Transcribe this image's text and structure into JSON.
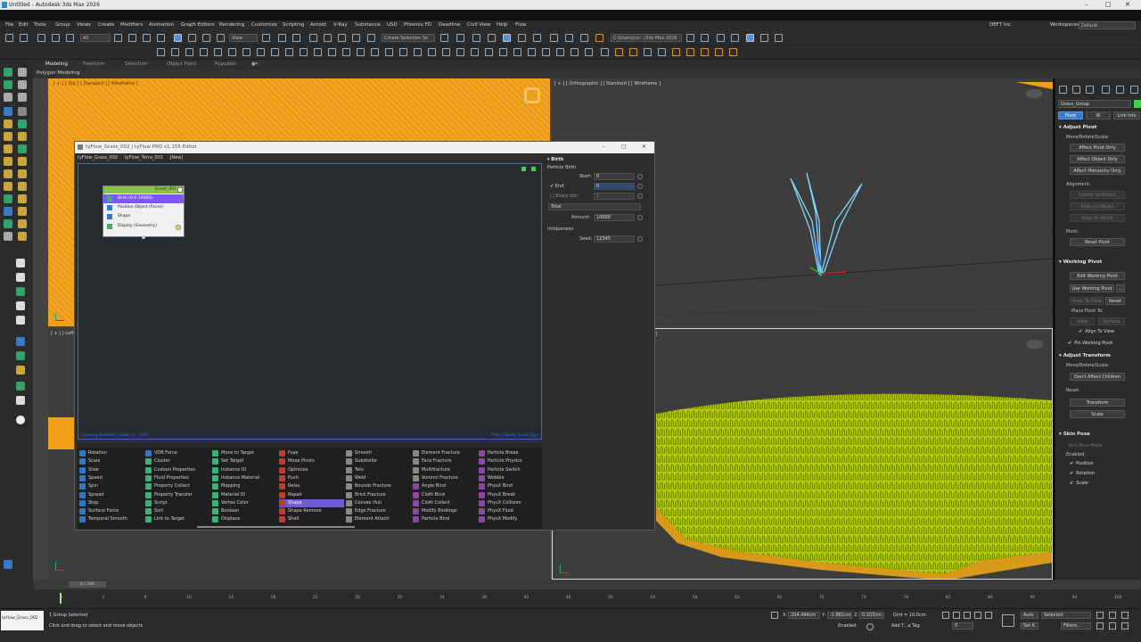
{
  "window": {
    "title": "Untitled - Autodesk 3ds Max 2026",
    "controls": [
      "–",
      "□",
      "✕"
    ]
  },
  "menu": [
    "File",
    "Edit",
    "Tools",
    "Group",
    "Views",
    "Create",
    "Modifiers",
    "Animation",
    "Graph Editors",
    "Rendering",
    "Customize",
    "Scripting",
    "Arnold",
    "V-Ray",
    "Substance",
    "USD",
    "Phoenix FD",
    "Deadline",
    "Civil View",
    "Help",
    "Flow"
  ],
  "account": "DEFT Inc.",
  "workspaces_label": "Workspaces:",
  "workspaces_value": "Default",
  "toolbar": {
    "filter_drop": "All",
    "view_drop": "View",
    "selection_set": "Create Selection Se",
    "project_path": "C:\\Users\\cor...\\3ds Max 2026"
  },
  "ribbon": {
    "tabs": [
      "Modeling",
      "Freeform",
      "Selection",
      "Object Paint",
      "Populate"
    ],
    "active_tab": "Modeling",
    "sub_label": "Polygon Modeling"
  },
  "viewports": {
    "top_left_label": "[ + ] [ Top ] [ Standard ] [ Wireframe ]",
    "top_right_label": "[ + ] [ Orthographic ] [ Standard ] [ Wireframe ]",
    "bottom_left_label": "[ + ] [ Left ]",
    "bottom_right_label": "]"
  },
  "tyflow": {
    "title": "tyFlow_Grass_002 | tyFlow PRO v1.155 Editor",
    "tabs": [
      "tyFlow_Grass_002",
      "tyFlow_Terra_001",
      "[New]"
    ],
    "event": {
      "name": "Event_001",
      "operators": [
        {
          "label": "Birth (0-0 10000)",
          "color": "#3bb273",
          "selected": true
        },
        {
          "label": "Position Object (Faces)",
          "color": "#2e79c7",
          "selected": false
        },
        {
          "label": "Shape",
          "color": "#2e79c7",
          "selected": false
        },
        {
          "label": "Display (Geometry)",
          "color": "#3bb273",
          "selected": false
        }
      ]
    },
    "status_left": "Caching enabled | Static [0 , 100]",
    "status_right": "Press Tab for QuickType",
    "props": {
      "section": "Birth",
      "sub": "Particle Birth",
      "start_label": "Start:",
      "start_value": "0",
      "end_label": "End:",
      "end_value": "0",
      "every_nth_label": "Every nth:",
      "every_nth_value": "1",
      "mode": "Total",
      "amount_label": "Amount:",
      "amount_value": "10000",
      "uniqueness_label": "Uniqueness",
      "seed_label": "Seed:",
      "seed_value": "12345"
    },
    "palette": [
      [
        {
          "l": "Rotation",
          "c": "#2e79c7"
        },
        {
          "l": "Scale",
          "c": "#2e79c7"
        },
        {
          "l": "Slow",
          "c": "#2e79c7"
        },
        {
          "l": "Speed",
          "c": "#2e79c7"
        },
        {
          "l": "Spin",
          "c": "#2e79c7"
        },
        {
          "l": "Spread",
          "c": "#2e79c7"
        },
        {
          "l": "Stop",
          "c": "#2e79c7"
        },
        {
          "l": "Surface Force",
          "c": "#2e79c7"
        },
        {
          "l": "Temporal Smooth",
          "c": "#2e79c7"
        }
      ],
      [
        {
          "l": "VDB Force",
          "c": "#2e79c7"
        },
        {
          "l": "Cluster",
          "c": "#3bb273"
        },
        {
          "l": "Custom Properties",
          "c": "#3bb273"
        },
        {
          "l": "Fluid Properties",
          "c": "#3bb273"
        },
        {
          "l": "Property Collect",
          "c": "#3bb273"
        },
        {
          "l": "Property Transfer",
          "c": "#3bb273"
        },
        {
          "l": "Script",
          "c": "#3bb273"
        },
        {
          "l": "Sort",
          "c": "#3bb273"
        },
        {
          "l": "Link to Target",
          "c": "#3bb273"
        }
      ],
      [
        {
          "l": "Move to Target",
          "c": "#3bb273"
        },
        {
          "l": "Set Target",
          "c": "#3bb273"
        },
        {
          "l": "Instance ID",
          "c": "#3bb273"
        },
        {
          "l": "Instance Material",
          "c": "#3bb273"
        },
        {
          "l": "Mapping",
          "c": "#3bb273"
        },
        {
          "l": "Material ID",
          "c": "#3bb273"
        },
        {
          "l": "Vertex Color",
          "c": "#3bb273"
        },
        {
          "l": "Boolean",
          "c": "#3bb273"
        },
        {
          "l": "Displace",
          "c": "#3bb273"
        }
      ],
      [
        {
          "l": "Fuse",
          "c": "#c0392b"
        },
        {
          "l": "Move Pivots",
          "c": "#c0392b"
        },
        {
          "l": "Optimize",
          "c": "#c0392b"
        },
        {
          "l": "Push",
          "c": "#c0392b"
        },
        {
          "l": "Relax",
          "c": "#c0392b"
        },
        {
          "l": "Repair",
          "c": "#c0392b"
        },
        {
          "l": "Shape",
          "c": "#c0392b",
          "hl": true
        },
        {
          "l": "Shape Remove",
          "c": "#c0392b"
        },
        {
          "l": "Shell",
          "c": "#c0392b"
        }
      ],
      [
        {
          "l": "Smooth",
          "c": "#888888"
        },
        {
          "l": "Subdivide",
          "c": "#888888"
        },
        {
          "l": "Tets",
          "c": "#888888"
        },
        {
          "l": "Weld",
          "c": "#888888"
        },
        {
          "l": "Bounds Fracture",
          "c": "#888888"
        },
        {
          "l": "Brick Fracture",
          "c": "#888888"
        },
        {
          "l": "Convex Hull",
          "c": "#888888"
        },
        {
          "l": "Edge Fracture",
          "c": "#888888"
        },
        {
          "l": "Element Attach",
          "c": "#888888"
        }
      ],
      [
        {
          "l": "Element Fracture",
          "c": "#888888"
        },
        {
          "l": "Face Fracture",
          "c": "#888888"
        },
        {
          "l": "Multifracture",
          "c": "#888888"
        },
        {
          "l": "Voronoi Fracture",
          "c": "#888888"
        },
        {
          "l": "Angle Bind",
          "c": "#8e44ad"
        },
        {
          "l": "Cloth Bind",
          "c": "#8e44ad"
        },
        {
          "l": "Cloth Collect",
          "c": "#8e44ad"
        },
        {
          "l": "Modify Bindings",
          "c": "#8e44ad"
        },
        {
          "l": "Particle Bind",
          "c": "#8e44ad"
        }
      ],
      [
        {
          "l": "Particle Break",
          "c": "#8e44ad"
        },
        {
          "l": "Particle Physics",
          "c": "#8e44ad"
        },
        {
          "l": "Particle Switch",
          "c": "#8e44ad"
        },
        {
          "l": "Wobble",
          "c": "#8e44ad"
        },
        {
          "l": "PhysX Bind",
          "c": "#8e44ad"
        },
        {
          "l": "PhysX Break",
          "c": "#8e44ad"
        },
        {
          "l": "PhysX Collision",
          "c": "#8e44ad"
        },
        {
          "l": "PhysX Fluid",
          "c": "#8e44ad"
        },
        {
          "l": "PhysX Modify",
          "c": "#8e44ad"
        }
      ]
    ]
  },
  "command_panel": {
    "object_name": "Grass_Group",
    "tabs": [
      "Pivot",
      "IK",
      "Link Info"
    ],
    "adjust_pivot": {
      "title": "Adjust Pivot",
      "move_label": "Move/Rotate/Scale:",
      "buttons": [
        "Affect Pivot Only",
        "Affect Object Only",
        "Affect Hierarchy Only"
      ],
      "alignment_label": "Alignment:",
      "align_buttons": [
        "Center to Object",
        "Align to Object",
        "Align to World"
      ],
      "pivot_label": "Pivot:",
      "reset_pivot": "Reset Pivot"
    },
    "working_pivot": {
      "title": "Working Pivot",
      "edit": "Edit Working Pivot",
      "use": "Use Working Pivot",
      "use_extra": "...",
      "align_to_view": "Align To View",
      "reset": "Reset",
      "place_label": "Place Pivot To:",
      "place_view": "View",
      "place_surface": "Surface",
      "chk_align": "Align To View",
      "chk_pin": "Pin Working Pivot"
    },
    "adjust_transform": {
      "title": "Adjust Transform",
      "move_label": "Move/Rotate/Scale:",
      "dont_affect": "Don't Affect Children",
      "reset_label": "Reset:",
      "transform": "Transform",
      "scale": "Scale"
    },
    "skin_pose": {
      "title": "Skin Pose",
      "skin_pose_mode": "Skin Pose Mode",
      "enabled_label": "Enabled:",
      "checks": [
        "Position",
        "Rotation",
        "Scale"
      ]
    }
  },
  "timeline": {
    "frame_display": "0 / 100",
    "ticks": [
      "0",
      "2",
      "6",
      "10",
      "14",
      "18",
      "22",
      "26",
      "30",
      "34",
      "38",
      "42",
      "46",
      "50",
      "54",
      "58",
      "62",
      "66",
      "70",
      "74",
      "78",
      "82",
      "86",
      "90",
      "94",
      "100"
    ]
  },
  "status": {
    "selection_count": "1 Group Selected",
    "prompt": "Click and drag to select and move objects",
    "script_box": "tyFlow_Grass_002",
    "x_label": "X:",
    "x_value": "204.494cm",
    "y_label": "Y:",
    "y_value": "-1.861cm",
    "z_label": "Z:",
    "z_value": "0.103cm",
    "grid": "Grid = 10.0cm",
    "enabled_label": "Enabled:",
    "add_tag": "Add T...a Tag",
    "auto": "Auto",
    "selected": "Selected",
    "set_k": "Set K.",
    "filters": "Filters...",
    "frame": "0"
  },
  "colors": {
    "orange_ground": "#f2a01a",
    "grass": "#b8d21a",
    "tyflow_canvas": "#252b2f",
    "accent_blue": "#3a7bc8"
  }
}
